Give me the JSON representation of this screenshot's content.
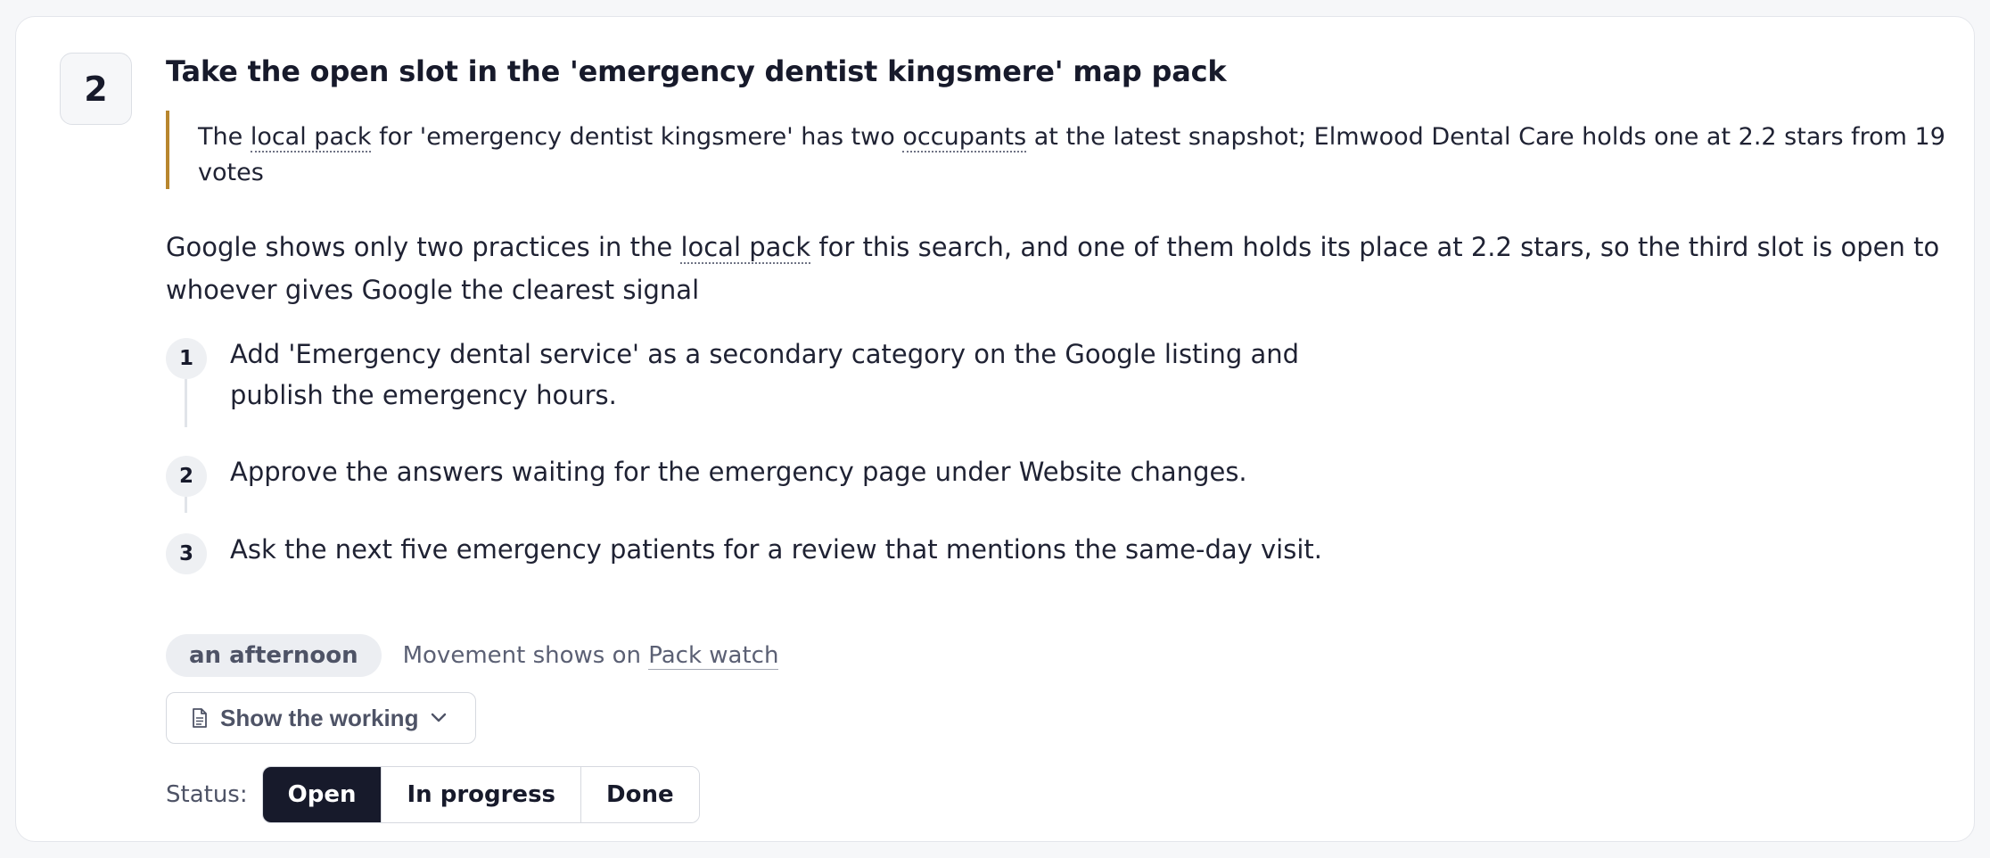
{
  "card": {
    "number": "2",
    "title": "Take the open slot in the 'emergency dentist kingsmere' map pack",
    "quote": {
      "p1": "The ",
      "term1": "local pack",
      "p2": " for 'emergency dentist kingsmere' has two ",
      "term2": "occupants",
      "p3": " at the latest snapshot; Elmwood Dental Care holds one at 2.2 stars from 19 votes"
    },
    "lead": {
      "p1": "Google shows only two practices in the ",
      "term": "local pack",
      "p2": " for this search, and one of them holds its place at 2.2 stars, so the third slot is open to whoever gives Google the clearest signal"
    },
    "steps": [
      {
        "number": "1",
        "text": "Add 'Emergency dental service' as a secondary category on the Google listing and publish the emergency hours."
      },
      {
        "number": "2",
        "text": "Approve the answers waiting for the emergency page under Website changes."
      },
      {
        "number": "3",
        "text": "Ask the next five emergency patients for a review that mentions the same-day visit."
      }
    ],
    "effort": "an afternoon",
    "movement_prefix": "Movement shows on ",
    "movement_link": "Pack watch",
    "working_label": "Show the working",
    "status": {
      "label": "Status:",
      "options": [
        "Open",
        "In progress",
        "Done"
      ],
      "selected": "Open"
    }
  },
  "colors": {
    "accent_bar": "#b8862e",
    "active_status": "#171a2b"
  }
}
